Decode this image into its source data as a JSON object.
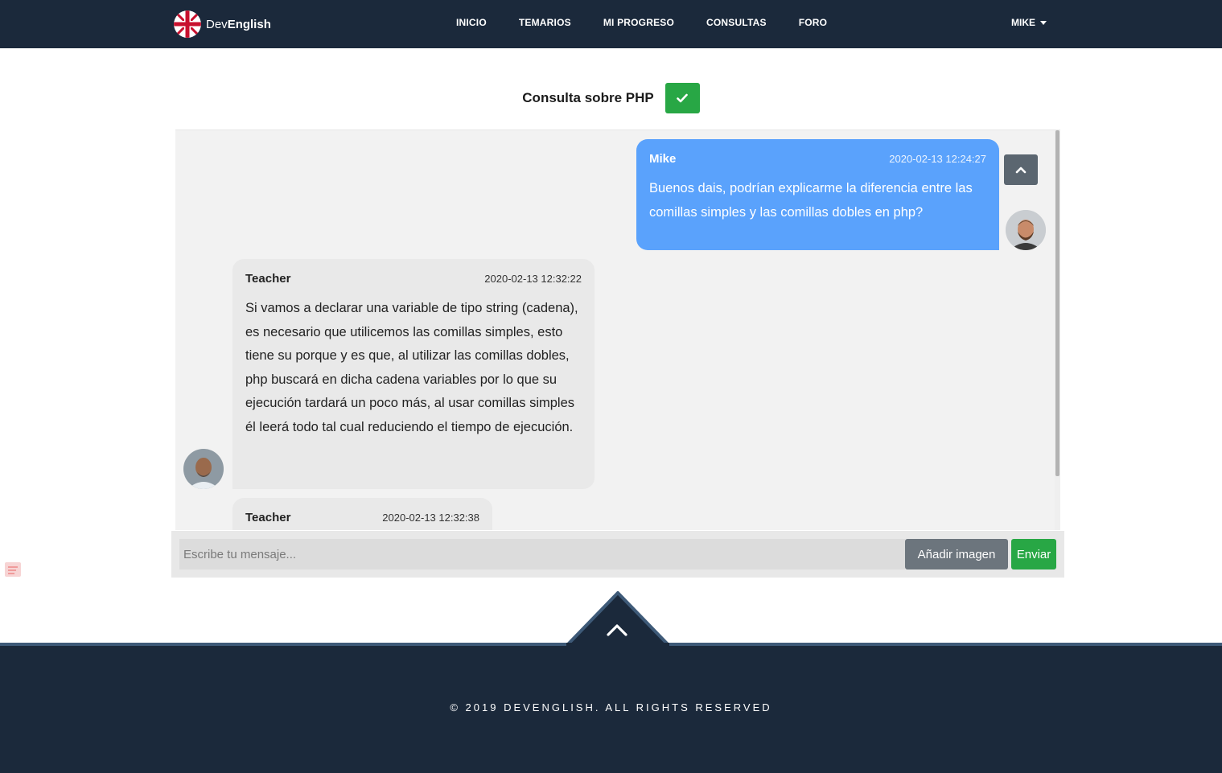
{
  "nav": {
    "brand_light": "Dev",
    "brand_bold": "English",
    "links": [
      "INICIO",
      "TEMARIOS",
      "MI PROGRESO",
      "CONSULTAS",
      "FORO"
    ],
    "user": "MIKE"
  },
  "page": {
    "title": "Consulta sobre PHP"
  },
  "chat": {
    "messages": [
      {
        "author": "Mike",
        "time": "2020-02-13 12:24:27",
        "text": "Buenos dais, podrían explicarme la diferencia entre las comillas simples y las comillas dobles en php?"
      },
      {
        "author": "Teacher",
        "time": "2020-02-13 12:32:22",
        "text": "Si vamos a declarar una variable de tipo string (cadena), es necesario que utilicemos las comillas simples, esto tiene su porque y es que, al utilizar las comillas dobles, php buscará en dicha cadena variables por lo que su ejecución tardará un poco más, al usar comillas simples él leerá todo tal cual reduciendo el tiempo de ejecución."
      },
      {
        "author": "Teacher",
        "time": "2020-02-13 12:32:38",
        "text": ""
      }
    ],
    "input_placeholder": "Escribe tu mensaje...",
    "add_image_label": "Añadir imagen",
    "send_label": "Enviar"
  },
  "footer": {
    "copyright": "© 2019 DEVENGLISH. ALL RIGHTS RESERVED"
  },
  "colors": {
    "navbar": "#1b293b",
    "accent_green": "#28a745",
    "mike_bubble": "#5aa2fc",
    "teacher_bubble": "#e9e9e9",
    "secondary_button": "#6c757d"
  },
  "icons": {
    "resolved": "check-icon",
    "scroll_top": "chevron-up-icon",
    "footer_top": "chevron-up-icon",
    "user_menu": "caret-down-icon",
    "brand": "uk-flag-icon"
  }
}
